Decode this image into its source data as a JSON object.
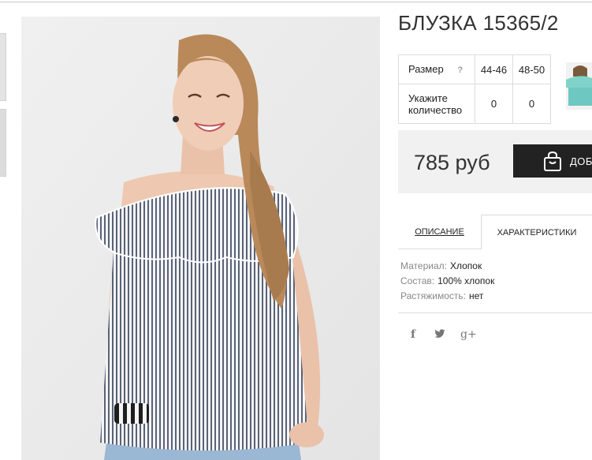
{
  "product": {
    "title": "БЛУЗКА 15365/2"
  },
  "size_table": {
    "size_label": "Размер",
    "help_mark": "?",
    "qty_label": "Укажите количество",
    "sizes": [
      "44-46",
      "48-50"
    ],
    "quantities": [
      "0",
      "0"
    ]
  },
  "price": {
    "amount": "785 руб",
    "add_button_label": "ДОБА"
  },
  "tabs": {
    "description": "ОПИСАНИЕ",
    "characteristics": "ХАРАКТЕРИСТИКИ",
    "active": "characteristics"
  },
  "characteristics": [
    {
      "key": "Материал:",
      "value": "Хлопок"
    },
    {
      "key": "Состав:",
      "value": "100% хлопок"
    },
    {
      "key": "Растяжимость:",
      "value": "нет"
    }
  ],
  "social": {
    "facebook": "f",
    "twitter": "twitter-icon",
    "googleplus": "g+"
  },
  "colors": {
    "price_bg": "#f1f1f1",
    "button_bg": "#222222",
    "border": "#dcdcdc"
  }
}
